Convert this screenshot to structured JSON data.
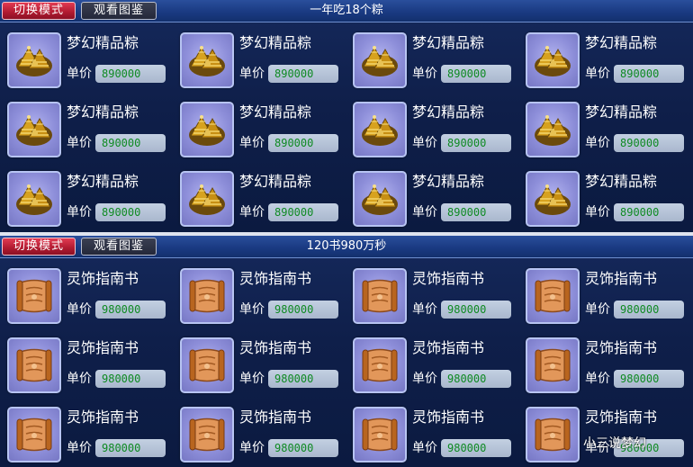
{
  "top_panel": {
    "mode_button": "切换模式",
    "book_button": "观看图鉴",
    "title": "一年吃18个粽",
    "items": [
      {
        "name": "梦幻精品粽",
        "price_label": "单价",
        "price": "890000"
      },
      {
        "name": "梦幻精品粽",
        "price_label": "单价",
        "price": "890000"
      },
      {
        "name": "梦幻精品粽",
        "price_label": "单价",
        "price": "890000"
      },
      {
        "name": "梦幻精品粽",
        "price_label": "单价",
        "price": "890000"
      },
      {
        "name": "梦幻精品粽",
        "price_label": "单价",
        "price": "890000"
      },
      {
        "name": "梦幻精品粽",
        "price_label": "单价",
        "price": "890000"
      },
      {
        "name": "梦幻精品粽",
        "price_label": "单价",
        "price": "890000"
      },
      {
        "name": "梦幻精品粽",
        "price_label": "单价",
        "price": "890000"
      },
      {
        "name": "梦幻精品粽",
        "price_label": "单价",
        "price": "890000"
      },
      {
        "name": "梦幻精品粽",
        "price_label": "单价",
        "price": "890000"
      },
      {
        "name": "梦幻精品粽",
        "price_label": "单价",
        "price": "890000"
      },
      {
        "name": "梦幻精品粽",
        "price_label": "单价",
        "price": "890000"
      }
    ]
  },
  "bottom_panel": {
    "mode_button": "切换模式",
    "book_button": "观看图鉴",
    "title": "120书980万秒",
    "items": [
      {
        "name": "灵饰指南书",
        "price_label": "单价",
        "price": "980000"
      },
      {
        "name": "灵饰指南书",
        "price_label": "单价",
        "price": "980000"
      },
      {
        "name": "灵饰指南书",
        "price_label": "单价",
        "price": "980000"
      },
      {
        "name": "灵饰指南书",
        "price_label": "单价",
        "price": "980000"
      },
      {
        "name": "灵饰指南书",
        "price_label": "单价",
        "price": "980000"
      },
      {
        "name": "灵饰指南书",
        "price_label": "单价",
        "price": "980000"
      },
      {
        "name": "灵饰指南书",
        "price_label": "单价",
        "price": "980000"
      },
      {
        "name": "灵饰指南书",
        "price_label": "单价",
        "price": "980000"
      },
      {
        "name": "灵饰指南书",
        "price_label": "单价",
        "price": "980000"
      },
      {
        "name": "灵饰指南书",
        "price_label": "单价",
        "price": "980000"
      },
      {
        "name": "灵饰指南书",
        "price_label": "单价",
        "price": "980000"
      },
      {
        "name": "灵饰指南书",
        "price_label": "单价",
        "price": "980000"
      }
    ]
  },
  "icons": {
    "top_item": "zongzi-icon",
    "bottom_item": "scroll-icon"
  },
  "colors": {
    "price_text": "#0e8a22",
    "mode_button": "#c8243a",
    "header": "#1e428a",
    "icon_bg": "#9192de"
  },
  "watermark": "小三说梦幻"
}
